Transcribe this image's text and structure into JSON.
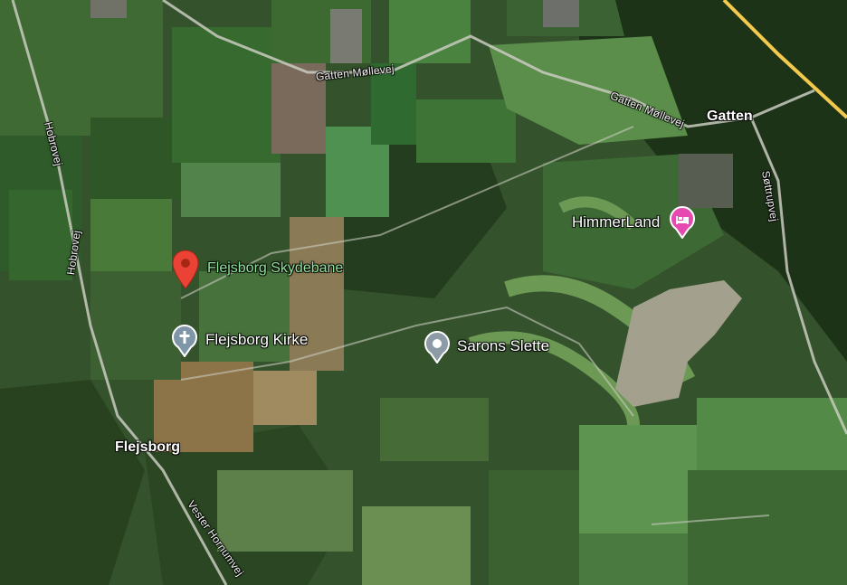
{
  "map": {
    "view": "satellite"
  },
  "places": {
    "gatten": "Gatten",
    "flejsborg": "Flejsborg"
  },
  "roads": {
    "gatten_mollevej_1": "Gatten Møllevej",
    "gatten_mollevej_2": "Gatten Møllevej",
    "hobrovej_1": "Hobrovej",
    "hobrovej_2": "Hobrovej",
    "sottrupvej": "Søttrupvej",
    "vester_hornumvej": "Vester Hornumvej"
  },
  "pois": {
    "flejsborg_skydebane": "Flejsborg Skydebane",
    "flejsborg_kirke": "Flejsborg Kirke",
    "sarons_slette": "Sarons Slette",
    "himmerland": "HimmerLand"
  },
  "colors": {
    "selected_pin": "#ea4335",
    "church_pin": "#7f96a8",
    "generic_pin": "#8d9ba6",
    "hotel_pin": "#e64ab0",
    "selected_label": "#8fe39a",
    "highway": "#f2c94c"
  },
  "icons": {
    "selected_pin": "map-pin-icon",
    "church": "church-cross-icon",
    "generic": "place-dot-icon",
    "hotel": "hotel-bed-icon"
  }
}
